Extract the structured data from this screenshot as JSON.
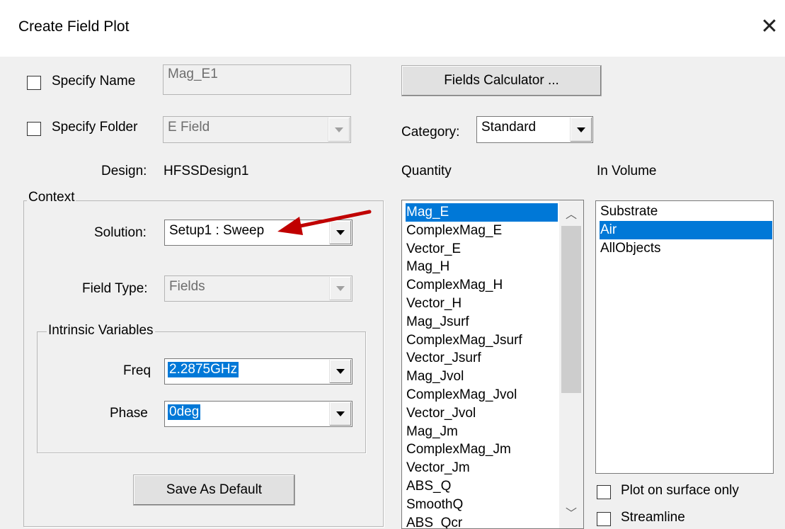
{
  "window": {
    "title": "Create Field Plot"
  },
  "specify_name": {
    "label": "Specify Name",
    "value": "Mag_E1",
    "checked": false
  },
  "specify_folder": {
    "label": "Specify Folder",
    "value": "E Field",
    "checked": false
  },
  "design": {
    "label": "Design:",
    "value": "HFSSDesign1"
  },
  "context": {
    "label": "Context",
    "solution": {
      "label": "Solution:",
      "value": "Setup1 : Sweep"
    },
    "field_type": {
      "label": "Field Type:",
      "value": "Fields"
    },
    "intrinsic": {
      "label": "Intrinsic Variables",
      "freq": {
        "label": "Freq",
        "value": "2.2875GHz"
      },
      "phase": {
        "label": "Phase",
        "value": "0deg"
      }
    }
  },
  "buttons": {
    "save_default": "Save As Default",
    "fields_calc": "Fields Calculator ..."
  },
  "category": {
    "label": "Category:",
    "value": "Standard"
  },
  "quantity": {
    "label": "Quantity",
    "items": [
      "Mag_E",
      "ComplexMag_E",
      "Vector_E",
      "Mag_H",
      "ComplexMag_H",
      "Vector_H",
      "Mag_Jsurf",
      "ComplexMag_Jsurf",
      "Vector_Jsurf",
      "Mag_Jvol",
      "ComplexMag_Jvol",
      "Vector_Jvol",
      "Mag_Jm",
      "ComplexMag_Jm",
      "Vector_Jm",
      "ABS_Q",
      "SmoothQ",
      "ABS_Qcr"
    ],
    "selected": "Mag_E"
  },
  "in_volume": {
    "label": "In Volume",
    "items": [
      "Substrate",
      "Air",
      "AllObjects"
    ],
    "selected": "Air"
  },
  "plot_surface_only": {
    "label": "Plot on surface only",
    "checked": false
  },
  "streamline": {
    "label": "Streamline",
    "checked": false
  },
  "colors": {
    "selection": "#0078d7",
    "annotation_arrow": "#c00000"
  }
}
